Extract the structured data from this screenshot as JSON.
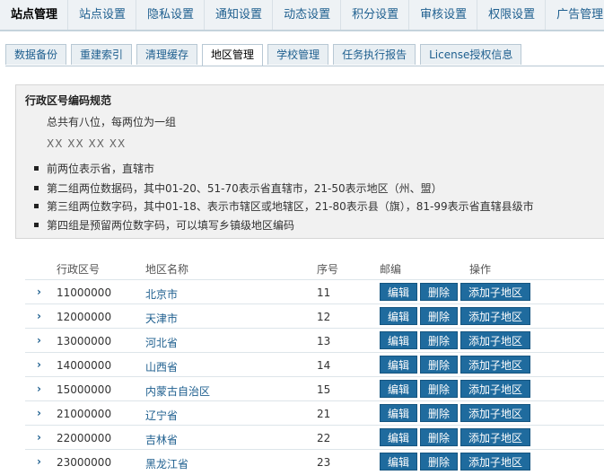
{
  "topnav": {
    "items": [
      "站点管理",
      "站点设置",
      "隐私设置",
      "通知设置",
      "动态设置",
      "积分设置",
      "审核设置",
      "权限设置",
      "广告管理",
      "友"
    ]
  },
  "subtabs": [
    "数据备份",
    "重建索引",
    "清理缓存",
    "地区管理",
    "学校管理",
    "任务执行报告",
    "License授权信息"
  ],
  "info": {
    "title": "行政区号编码规范",
    "line1": "总共有八位，每两位为一组",
    "line2": "XX  XX  XX  XX",
    "rules": [
      "前两位表示省，直辖市",
      "第二组两位数据码，其中01-20、51-70表示省直辖市，21-50表示地区（州、盟）",
      "第三组两位数字码，其中01-18、表示市辖区或地辖区，21-80表示县（旗），81-99表示省直辖县级市",
      "第四组是预留两位数字码，可以填写乡镇级地区编码"
    ]
  },
  "table": {
    "headers": {
      "code": "行政区号",
      "name": "地区名称",
      "seq": "序号",
      "edit": "邮编",
      "ops": "操作"
    },
    "buttons": {
      "edit": "编辑",
      "delete": "删除",
      "add_child": "添加子地区"
    },
    "arrow": "›",
    "rows": [
      {
        "code": "11000000",
        "name": "北京市",
        "seq": "11"
      },
      {
        "code": "12000000",
        "name": "天津市",
        "seq": "12"
      },
      {
        "code": "13000000",
        "name": "河北省",
        "seq": "13"
      },
      {
        "code": "14000000",
        "name": "山西省",
        "seq": "14"
      },
      {
        "code": "15000000",
        "name": "内蒙古自治区",
        "seq": "15"
      },
      {
        "code": "21000000",
        "name": "辽宁省",
        "seq": "21"
      },
      {
        "code": "22000000",
        "name": "吉林省",
        "seq": "22"
      },
      {
        "code": "23000000",
        "name": "黑龙江省",
        "seq": "23"
      }
    ]
  }
}
